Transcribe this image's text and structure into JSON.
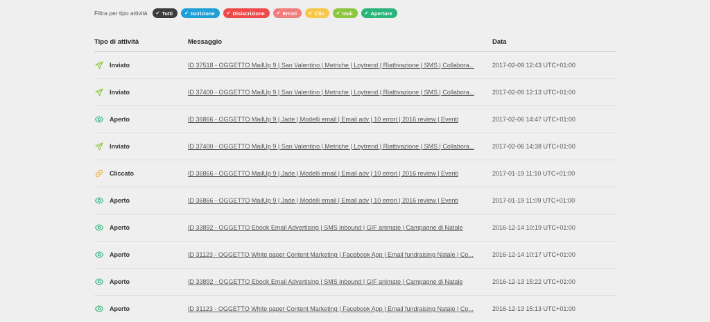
{
  "filter": {
    "label": "Filtra per tipo attività",
    "chips": [
      {
        "label": "Tutti",
        "color": "#3b3b3b"
      },
      {
        "label": "Iscrizione",
        "color": "#1e9fd6"
      },
      {
        "label": "Disiscrizione",
        "color": "#ef4a4a"
      },
      {
        "label": "Errori",
        "color": "#f27d7d"
      },
      {
        "label": "Clic",
        "color": "#f7c74a"
      },
      {
        "label": "Invii",
        "color": "#8cc63f"
      },
      {
        "label": "Aperture",
        "color": "#2ab47a"
      }
    ]
  },
  "table": {
    "headers": {
      "type": "Tipo di attività",
      "message": "Messaggio",
      "date": "Data"
    },
    "rows": [
      {
        "icon": "paper-plane-icon",
        "type": "Inviato",
        "message": "ID 37518 - OGGETTO MailUp 9 | San Valentino | Metriche | Loytrend | Riattivazione | SMS | Collabora...",
        "date": "2017-02-09 12:43 UTC+01:00"
      },
      {
        "icon": "paper-plane-icon",
        "type": "Inviato",
        "message": "ID 37400 - OGGETTO MailUp 9 | San Valentino | Metriche | Loytrend | Riattivazione | SMS | Collabora...",
        "date": "2017-02-09 12:13 UTC+01:00"
      },
      {
        "icon": "eye-icon",
        "type": "Aperto",
        "message": "ID 36866 - OGGETTO MailUp 9 | Jade | Modelli email | Email adv | 10 errori | 2016 review | Eventi",
        "date": "2017-02-06 14:47 UTC+01:00"
      },
      {
        "icon": "paper-plane-icon",
        "type": "Inviato",
        "message": "ID 37400 - OGGETTO MailUp 9 | San Valentino | Metriche | Loytrend | Riattivazione | SMS | Collabora...",
        "date": "2017-02-06 14:38 UTC+01:00"
      },
      {
        "icon": "link-icon",
        "type": "Cliccato",
        "message": "ID 36866 - OGGETTO MailUp 9 | Jade | Modelli email | Email adv | 10 errori | 2016 review | Eventi",
        "date": "2017-01-19 11:10 UTC+01:00"
      },
      {
        "icon": "eye-icon",
        "type": "Aperto",
        "message": "ID 36866 - OGGETTO MailUp 9 | Jade | Modelli email | Email adv | 10 errori | 2016 review | Eventi",
        "date": "2017-01-19 11:09 UTC+01:00"
      },
      {
        "icon": "eye-icon",
        "type": "Aperto",
        "message": "ID 33892 - OGGETTO Ebook Email Advertising | SMS inbound | GIF animate | Campagne di Natale",
        "date": "2016-12-14 10:19 UTC+01:00"
      },
      {
        "icon": "eye-icon",
        "type": "Aperto",
        "message": "ID 31123 - OGGETTO White paper Content Marketing | Facebook App | Email fundraising Natale | Co...",
        "date": "2016-12-14 10:17 UTC+01:00"
      },
      {
        "icon": "eye-icon",
        "type": "Aperto",
        "message": "ID 33892 - OGGETTO Ebook Email Advertising | SMS inbound | GIF animate | Campagne di Natale",
        "date": "2016-12-13 15:22 UTC+01:00"
      },
      {
        "icon": "eye-icon",
        "type": "Aperto",
        "message": "ID 31123 - OGGETTO White paper Content Marketing | Facebook App | Email fundraising Natale | Co...",
        "date": "2016-12-13 15:13 UTC+01:00"
      }
    ]
  },
  "icon_colors": {
    "paper-plane-icon": "#8cc63f",
    "eye-icon": "#2ab47a",
    "link-icon": "#f2b134"
  }
}
